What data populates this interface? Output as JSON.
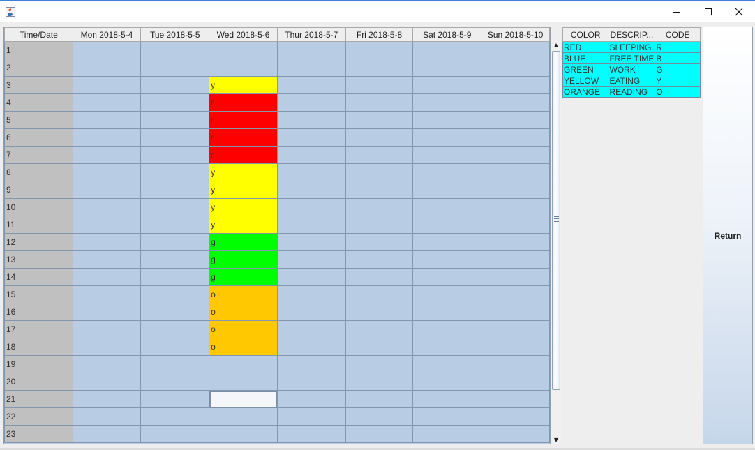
{
  "window": {
    "app_icon": "java-cup-icon",
    "controls": {
      "minimize": "minimize-icon",
      "maximize": "maximize-icon",
      "close": "close-icon"
    }
  },
  "schedule": {
    "columns": [
      "Time/Date",
      "Mon 2018-5-4",
      "Tue 2018-5-5",
      "Wed 2018-5-6",
      "Thur 2018-5-7",
      "Fri 2018-5-8",
      "Sat 2018-5-9",
      "Sun 2018-5-10"
    ],
    "rows": [
      {
        "time": "1",
        "cells": [
          "",
          "",
          "",
          "",
          "",
          "",
          ""
        ]
      },
      {
        "time": "2",
        "cells": [
          "",
          "",
          "",
          "",
          "",
          "",
          ""
        ]
      },
      {
        "time": "3",
        "cells": [
          "",
          "",
          "y",
          "",
          "",
          "",
          ""
        ]
      },
      {
        "time": "4",
        "cells": [
          "",
          "",
          "r",
          "",
          "",
          "",
          ""
        ]
      },
      {
        "time": "5",
        "cells": [
          "",
          "",
          "r",
          "",
          "",
          "",
          ""
        ]
      },
      {
        "time": "6",
        "cells": [
          "",
          "",
          "r",
          "",
          "",
          "",
          ""
        ]
      },
      {
        "time": "7",
        "cells": [
          "",
          "",
          "r",
          "",
          "",
          "",
          ""
        ]
      },
      {
        "time": "8",
        "cells": [
          "",
          "",
          "y",
          "",
          "",
          "",
          ""
        ]
      },
      {
        "time": "9",
        "cells": [
          "",
          "",
          "y",
          "",
          "",
          "",
          ""
        ]
      },
      {
        "time": "10",
        "cells": [
          "",
          "",
          "y",
          "",
          "",
          "",
          ""
        ]
      },
      {
        "time": "11",
        "cells": [
          "",
          "",
          "y",
          "",
          "",
          "",
          ""
        ]
      },
      {
        "time": "12",
        "cells": [
          "",
          "",
          "g",
          "",
          "",
          "",
          ""
        ]
      },
      {
        "time": "13",
        "cells": [
          "",
          "",
          "g",
          "",
          "",
          "",
          ""
        ]
      },
      {
        "time": "14",
        "cells": [
          "",
          "",
          "g",
          "",
          "",
          "",
          ""
        ]
      },
      {
        "time": "15",
        "cells": [
          "",
          "",
          "o",
          "",
          "",
          "",
          ""
        ]
      },
      {
        "time": "16",
        "cells": [
          "",
          "",
          "o",
          "",
          "",
          "",
          ""
        ]
      },
      {
        "time": "17",
        "cells": [
          "",
          "",
          "o",
          "",
          "",
          "",
          ""
        ]
      },
      {
        "time": "18",
        "cells": [
          "",
          "",
          "o",
          "",
          "",
          "",
          ""
        ]
      },
      {
        "time": "19",
        "cells": [
          "",
          "",
          "",
          "",
          "",
          "",
          ""
        ]
      },
      {
        "time": "20",
        "cells": [
          "",
          "",
          "",
          "",
          "",
          "",
          ""
        ]
      },
      {
        "time": "21",
        "cells": [
          "",
          "",
          "",
          "",
          "",
          "",
          ""
        ]
      },
      {
        "time": "22",
        "cells": [
          "",
          "",
          "",
          "",
          "",
          "",
          ""
        ]
      },
      {
        "time": "23",
        "cells": [
          "",
          "",
          "",
          "",
          "",
          "",
          ""
        ]
      }
    ],
    "selected_cell": {
      "row": 20,
      "col": 2
    },
    "code_colors": {
      "y": "#ffff00",
      "r": "#ff0000",
      "g": "#00ff00",
      "o": "#ffc800"
    }
  },
  "legend": {
    "columns": [
      "COLOR",
      "DESCRIP...",
      "CODE"
    ],
    "rows": [
      [
        "RED",
        "SLEEPING",
        "R"
      ],
      [
        "BLUE",
        "FREE TIME",
        "B"
      ],
      [
        "GREEN",
        "WORK",
        "G"
      ],
      [
        "YELLOW",
        "EATING",
        "Y"
      ],
      [
        "ORANGE",
        "READING",
        "O"
      ]
    ],
    "row_color": "#00ffff"
  },
  "return_button": {
    "label": "Return"
  }
}
